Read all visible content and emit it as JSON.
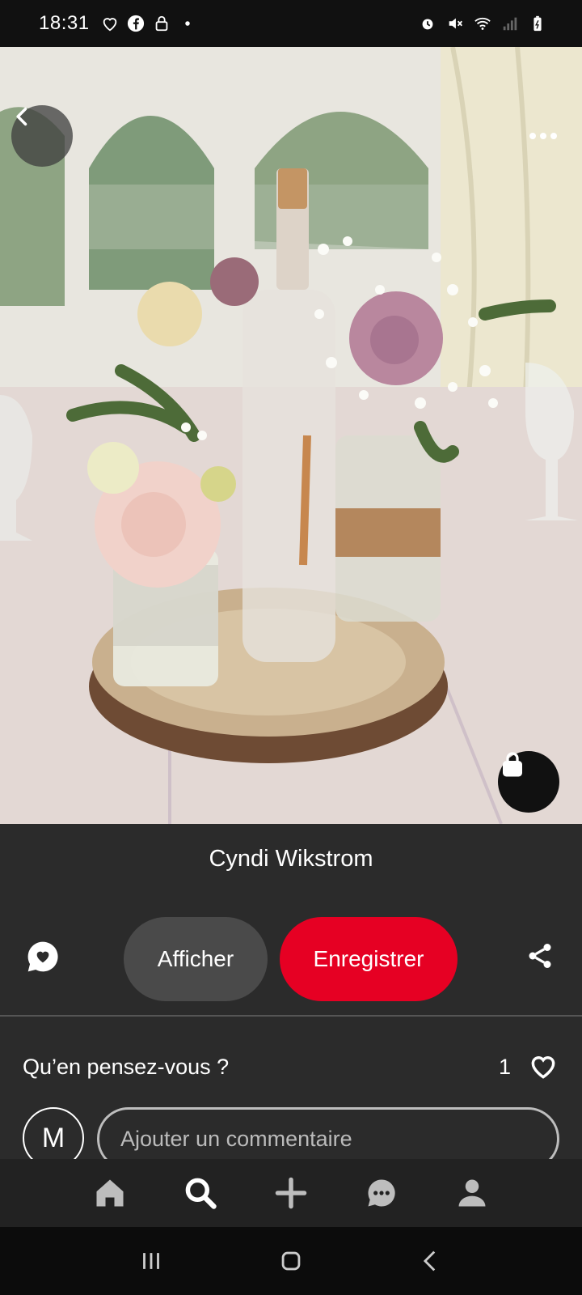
{
  "status_bar": {
    "time": "18:31",
    "left_icons": [
      "heart-icon",
      "facebook-icon",
      "lock-icon",
      "dot-icon"
    ],
    "right_icons": [
      "alarm-icon",
      "mute-icon",
      "wifi-icon",
      "signal-icon",
      "battery-icon"
    ]
  },
  "pin": {
    "author": "Cyndi Wikstrom",
    "view_label": "Afficher",
    "save_label": "Enregistrer",
    "feedback_question": "Qu’en pensez-vous ?",
    "like_count": "1"
  },
  "comment": {
    "avatar_letter": "M",
    "placeholder": "Ajouter un commentaire"
  },
  "bottom_nav": [
    "home-icon",
    "search-icon",
    "add-icon",
    "messages-icon",
    "profile-icon"
  ],
  "colors": {
    "save_button": "#e60023",
    "view_button": "#4a4a4a",
    "sheet_background": "#2b2b2b"
  }
}
